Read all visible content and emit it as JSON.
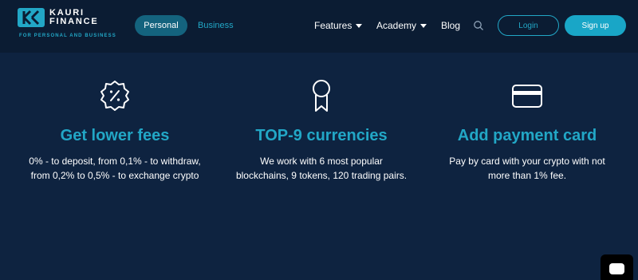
{
  "header": {
    "logo": {
      "line1": "KAURI",
      "line2": "FINANCE",
      "tagline": "FOR PERSONAL AND BUSINESS",
      "icon": "kauri-logo-mark"
    },
    "segments": {
      "personal": "Personal",
      "business": "Business"
    },
    "nav": {
      "features": "Features",
      "academy": "Academy",
      "blog": "Blog"
    },
    "search_icon": "search-icon",
    "login": "Login",
    "signup": "Sign up"
  },
  "features": [
    {
      "icon": "discount-badge-icon",
      "title": "Get lower fees",
      "text": "0% - to deposit, from 0,1% - to withdraw, from 0,2% to 0,5% - to exchange crypto"
    },
    {
      "icon": "award-medal-icon",
      "title": "TOP-9 currencies",
      "text": "We work with 6 most popular blockchains, 9 tokens, 120 trading pairs."
    },
    {
      "icon": "credit-card-icon",
      "title": "Add payment card",
      "text": "Pay by card with your crypto with not more than 1% fee."
    }
  ],
  "colors": {
    "background": "#0e2340",
    "header": "#0b1c33",
    "accent": "#22a7c6",
    "pill": "#14637e"
  }
}
